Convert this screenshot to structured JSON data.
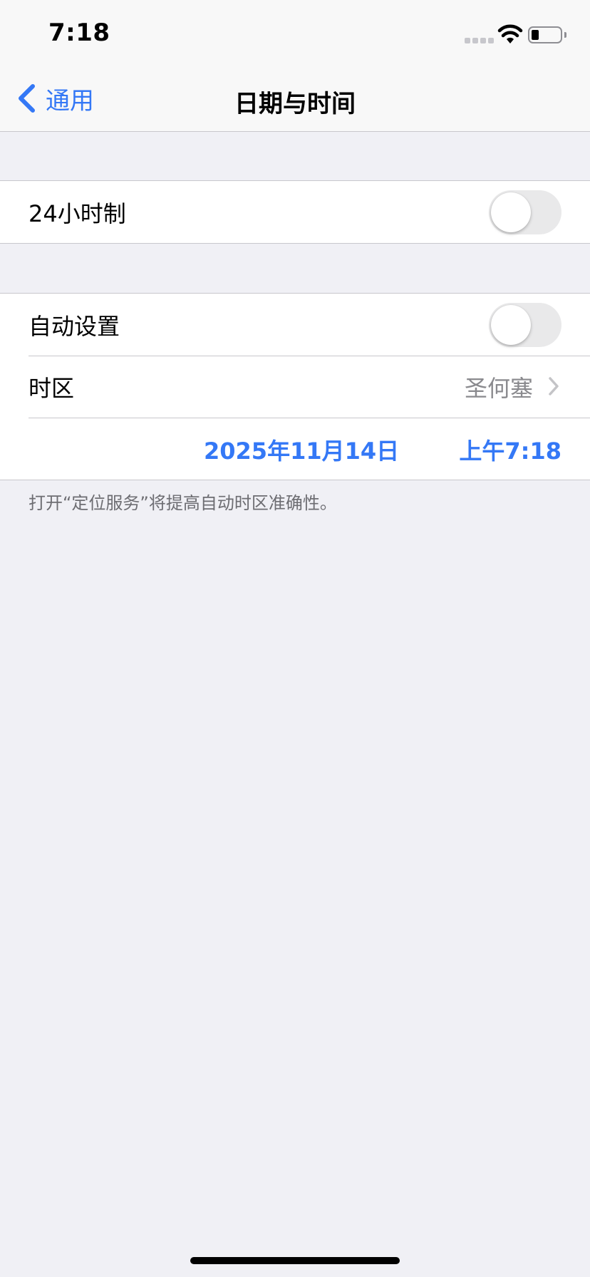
{
  "status_bar": {
    "time": "7:18",
    "battery_level": 0.25
  },
  "nav": {
    "back_label": "通用",
    "title": "日期与时间"
  },
  "group1": {
    "hour24_label": "24小时制",
    "hour24_on": false
  },
  "group2": {
    "auto_label": "自动设置",
    "auto_on": false,
    "timezone_label": "时区",
    "timezone_value": "圣何塞",
    "date": "2025年11月14日",
    "time": "上午7:18"
  },
  "footnote": "打开“定位服务”将提高自动时区准确性。",
  "colors": {
    "accent": "#3478f6",
    "background": "#f0f0f5",
    "secondary_text": "#8a8a8e",
    "toggle_off": "#e9e9ea"
  }
}
